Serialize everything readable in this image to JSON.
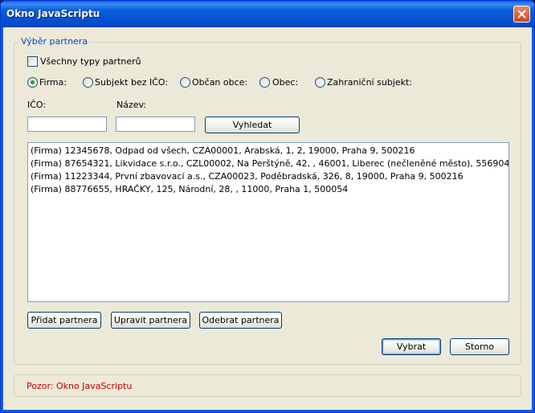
{
  "window": {
    "title": "Okno JavaScriptu"
  },
  "group": {
    "title": "Výběr partnera"
  },
  "all_types": {
    "label": "Všechny typy partnerů",
    "checked": false
  },
  "partner_types": [
    {
      "label": "Firma:",
      "checked": true
    },
    {
      "label": "Subjekt bez IČO:",
      "checked": false
    },
    {
      "label": "Občan obce:",
      "checked": false
    },
    {
      "label": "Obec:",
      "checked": false
    },
    {
      "label": "Zahraniční subjekt:",
      "checked": false
    }
  ],
  "search": {
    "ico_label": "IČO:",
    "ico_value": "",
    "nazev_label": "Název:",
    "nazev_value": "",
    "button_label": "Vyhledat"
  },
  "results": [
    "(Firma) 12345678, Odpad od všech, CZA00001, Arabská, 1, 2, 19000, Praha 9, 500216",
    "(Firma) 87654321, Likvidace s.r.o., CZL00002, Na Perštýně, 42, , 46001, Liberec (nečleněné město), 556904",
    "(Firma) 11223344, První zbavovací a.s., CZA00023, Poděbradská, 326, 8, 19000, Praha 9, 500216",
    "(Firma) 88776655, HRAČKY, 125, Národní, 28, , 11000, Praha 1, 500054"
  ],
  "actions": {
    "add": "Přidat partnera",
    "edit": "Upravit partnera",
    "remove": "Odebrat partnera"
  },
  "dialog": {
    "select": "Vybrat",
    "cancel": "Storno"
  },
  "status": {
    "text": "Pozor: Okno JavaScriptu",
    "color": "#c00000"
  },
  "colors": {
    "titlebar": "#0a5fd8",
    "group_title": "#0046d5",
    "radio_dot": "#21a121"
  }
}
